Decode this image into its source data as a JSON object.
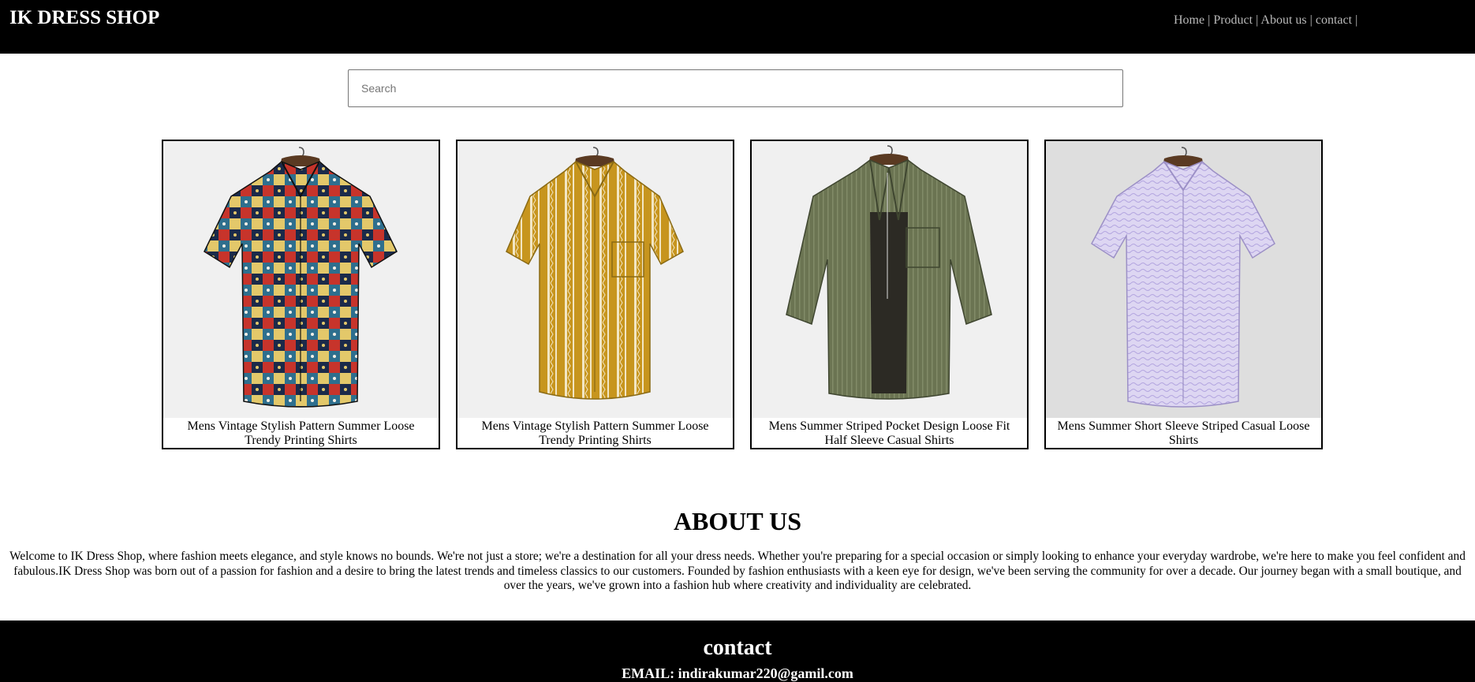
{
  "header": {
    "brand": "IK DRESS SHOP",
    "nav": [
      {
        "label": "Home"
      },
      {
        "label": "Product"
      },
      {
        "label": "About us"
      },
      {
        "label": "contact"
      }
    ],
    "separator": "|"
  },
  "search": {
    "placeholder": "Search",
    "value": ""
  },
  "products": [
    {
      "title": "Mens Vintage Stylish Pattern Summer Loose Trendy Printing Shirts",
      "image": "patchwork-print-shirt"
    },
    {
      "title": "Mens Vintage Stylish Pattern Summer Loose Trendy Printing Shirts",
      "image": "mustard-tribal-stripe-shirt"
    },
    {
      "title": "Mens Summer Striped Pocket Design Loose Fit Half Sleeve Casual Shirts",
      "image": "olive-striped-pocket-shirt"
    },
    {
      "title": "Mens Summer Short Sleeve Striped Casual Loose Shirts",
      "image": "lavender-wave-stripe-shirt"
    }
  ],
  "about": {
    "title": "ABOUT US",
    "text": "Welcome to IK Dress Shop, where fashion meets elegance, and style knows no bounds. We're not just a store; we're a destination for all your dress needs. Whether you're preparing for a special occasion or simply looking to enhance your everyday wardrobe, we're here to make you feel confident and fabulous.IK Dress Shop was born out of a passion for fashion and a desire to bring the latest trends and timeless classics to our customers. Founded by fashion enthusiasts with a keen eye for design, we've been serving the community for over a decade. Our journey began with a small boutique, and over the years, we've grown into a fashion hub where creativity and individuality are celebrated."
  },
  "contact": {
    "title": "contact",
    "email": "EMAIL: indirakumar220@gamil.com"
  },
  "colors": {
    "header_bg": "#000000",
    "nav_text": "#b9b9b9",
    "footer_bg": "#000000",
    "card_border": "#000000"
  }
}
